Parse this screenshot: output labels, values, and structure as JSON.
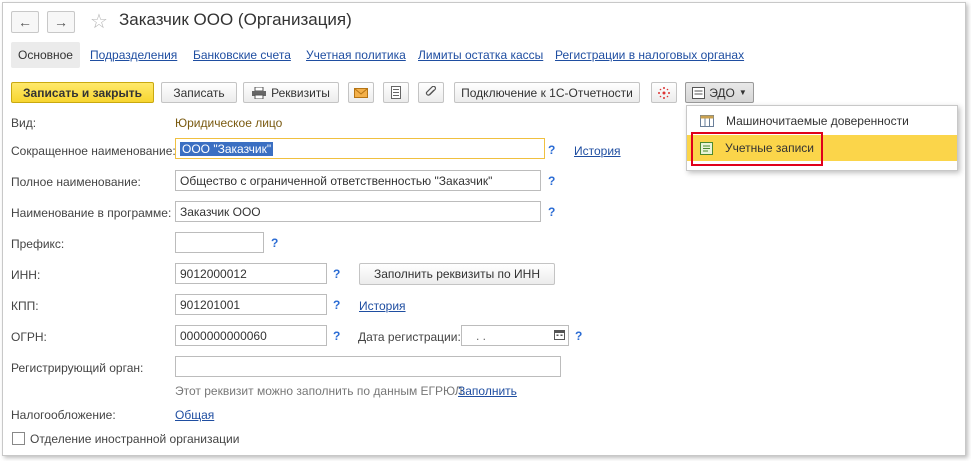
{
  "window": {
    "title": "Заказчик ООО (Организация)"
  },
  "nav": {
    "back": "←",
    "forward": "→",
    "star": "☆"
  },
  "tabs": [
    "Основное",
    "Подразделения",
    "Банковские счета",
    "Учетная политика",
    "Лимиты остатка кассы",
    "Регистрации в налоговых органах"
  ],
  "toolbar": {
    "save_close": "Записать и закрыть",
    "save": "Записать",
    "requisites": "Реквизиты",
    "connect": "Подключение к 1С-Отчетности",
    "edo": "ЭДО"
  },
  "edo_menu": {
    "items": [
      "Машиночитаемые доверенности",
      "Учетные записи"
    ]
  },
  "form": {
    "kind_label": "Вид:",
    "kind_value": "Юридическое лицо",
    "short_name_label": "Сокращенное наименование:",
    "short_name_value": "ООО \"Заказчик\"",
    "history": "История",
    "full_name_label": "Полное наименование:",
    "full_name_value": "Общество с ограниченной ответственностью \"Заказчик\"",
    "prog_name_label": "Наименование в программе:",
    "prog_name_value": "Заказчик ООО",
    "prefix_label": "Префикс:",
    "prefix_value": "",
    "inn_label": "ИНН:",
    "inn_value": "9012000012",
    "fill_inn_button": "Заполнить реквизиты по ИНН",
    "kpp_label": "КПП:",
    "kpp_value": "901201001",
    "ogrn_label": "ОГРН:",
    "ogrn_value": "0000000000060",
    "reg_date_label": "Дата регистрации:",
    "reg_date_value": ".  .",
    "reg_org_label": "Регистрирующий орган:",
    "reg_org_value": "",
    "egrul_hint": "Этот реквизит можно заполнить по данным ЕГРЮЛ.",
    "egrul_fill": "Заполнить",
    "tax_label": "Налогообложение:",
    "tax_value": "Общая",
    "foreign_label": "Отделение иностранной организации",
    "foreign_checked": false,
    "help": "?"
  },
  "colors": {
    "accent": "#f7d530",
    "link": "#1f4ea1",
    "highlight": "#fbd54a",
    "annotation": "#e0001b"
  }
}
